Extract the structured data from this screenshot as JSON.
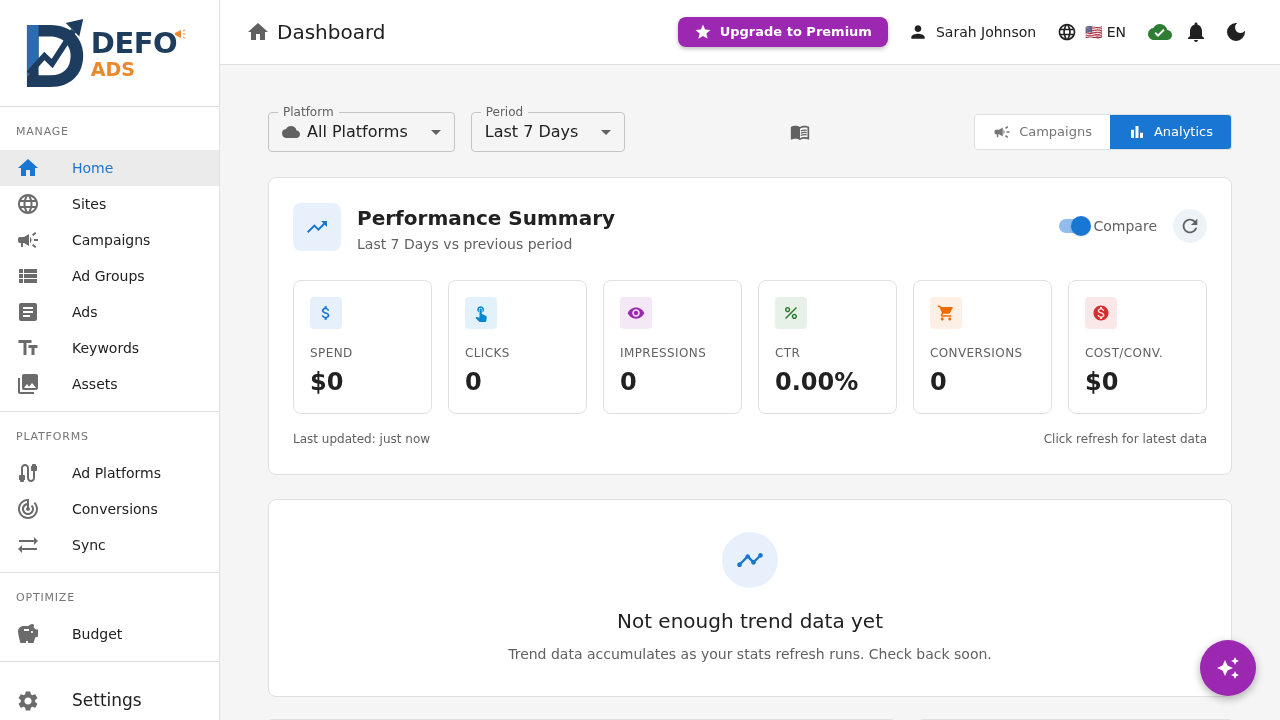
{
  "sidebar": {
    "logo": {
      "primary": "DEFO",
      "secondary": "ADS"
    },
    "sections": [
      {
        "title": "MANAGE",
        "items": [
          {
            "label": "Home",
            "selected": true
          },
          {
            "label": "Sites",
            "selected": false
          },
          {
            "label": "Campaigns",
            "selected": false
          },
          {
            "label": "Ad Groups",
            "selected": false
          },
          {
            "label": "Ads",
            "selected": false
          },
          {
            "label": "Keywords",
            "selected": false
          },
          {
            "label": "Assets",
            "selected": false
          }
        ]
      },
      {
        "title": "PLATFORMS",
        "items": [
          {
            "label": "Ad Platforms",
            "selected": false
          },
          {
            "label": "Conversions",
            "selected": false
          },
          {
            "label": "Sync",
            "selected": false
          }
        ]
      },
      {
        "title": "OPTIMIZE",
        "items": [
          {
            "label": "Budget",
            "selected": false
          }
        ]
      }
    ],
    "settings": {
      "label": "Settings",
      "selected": false
    }
  },
  "header": {
    "title": "Dashboard",
    "upgrade_button": "Upgrade to Premium",
    "user_name": "Sarah Johnson",
    "language": "🇺🇸 EN"
  },
  "filters": [
    {
      "label": "Platform",
      "value": "All Platforms"
    },
    {
      "label": "Period",
      "value": "Last 7 Days"
    }
  ],
  "view_toggle": [
    {
      "label": "Campaigns",
      "selected": false
    },
    {
      "label": "Analytics",
      "selected": true
    }
  ],
  "performance_summary": {
    "title": "Performance Summary",
    "subtitle": "Last 7 Days vs previous period",
    "compare": {
      "label": "Compare",
      "on": true
    },
    "metrics": [
      {
        "label": "SPEND",
        "value": "$0",
        "color": "#1976d2"
      },
      {
        "label": "CLICKS",
        "value": "0",
        "color": "#0288d1"
      },
      {
        "label": "IMPRESSIONS",
        "value": "0",
        "color": "#9c27b0"
      },
      {
        "label": "CTR",
        "value": "0.00%",
        "color": "#2e7d32"
      },
      {
        "label": "CONVERSIONS",
        "value": "0",
        "color": "#ed6c02"
      },
      {
        "label": "COST/CONV.",
        "value": "$0",
        "color": "#d32f2f"
      }
    ],
    "last_updated": "Last updated: just now",
    "refresh_hint": "Click refresh for latest data"
  },
  "trend_card": {
    "title": "Not enough trend data yet",
    "message": "Trend data accumulates as your stats refresh runs. Check back soon."
  }
}
